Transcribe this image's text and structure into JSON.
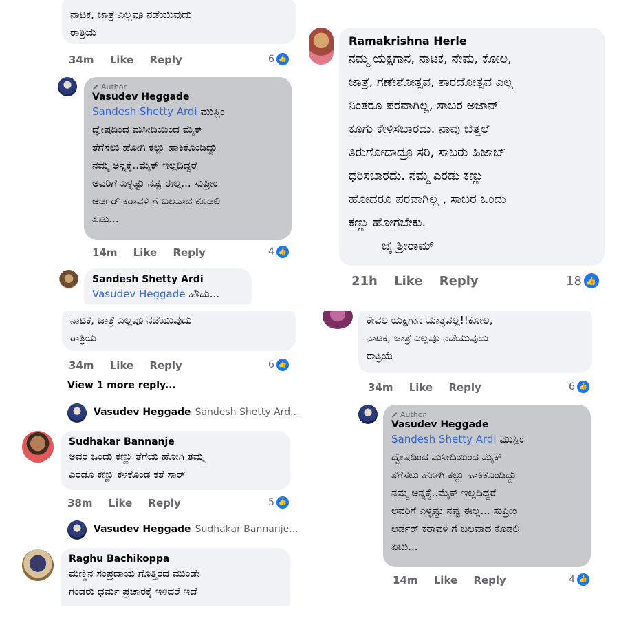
{
  "common": {
    "like": "Like",
    "reply": "Reply"
  },
  "tl": {
    "top_text": "ನಾಟಕ, ಜಾತ್ರೆ ಎಲ್ಲವೂ ನಡೆಯುವುದು",
    "top_text2": "ರಾತ್ರಿಯೆ",
    "top_time": "34m",
    "top_count": "6",
    "author_label": "Author",
    "reply_name": "Vasudev Heggade",
    "reply_mention": "Sandesh Shetty Ardi",
    "reply_line1": " ಮುಸ್ಲಿಂ",
    "reply_line2": "ದ್ವೇಷದಿಂದ ಮಸೀದಿಯಿಂದ ಮೈಕ್",
    "reply_line3": "ತೆಗೆಸಲು ಹೋಗಿ ಕಲ್ಲು ಹಾಕಿಕೊಂಡಿದ್ದು",
    "reply_line4": "ನಮ್ಮ ಅನ್ನಕ್ಕೆ..ಮೈಕ್ ಇಲ್ಲದಿದ್ದರೆ",
    "reply_line5": "ಅವರಿಗೆ ಎಳ್ಳಷ್ಟು ನಷ್ಟ ಈಲ್ಲ... ಸುಪ್ರೀಂ",
    "reply_line6": "ಆರ್ಡರ್ ಕರಾವಳಿ ಗೆ  ಬಲವಾದ ಕೊಡಲಿ",
    "reply_line7": "ಏಟು...",
    "reply_time": "14m",
    "reply_count": "4",
    "s_name": "Sandesh Shetty Ardi",
    "s_mention": "Vasudev Heggade",
    "s_text": " ಹೌದು..."
  },
  "tr": {
    "name": "Ramakrishna Herle",
    "line1": "ನಮ್ಮ ಯಕ್ಷಗಾನ, ನಾಟಕ, ನೇಮ, ಕೋಲ,",
    "line2": "ಜಾತ್ರೆ, ಗಣೇಶೋತ್ಸವ, ಶಾರದೋತ್ಸವ ಎಲ್ಲ",
    "line3": "ನಿಂತರೂ ಪರವಾಗಿಲ್ಲ, ಸಾಬರ ಅಜಾನ್",
    "line4": "ಕೂಗು ಕೇಳಿಸಬಾರದು. ನಾವು ಬೆತ್ತಲೆ",
    "line5": "ತಿರುಗೋದಾದ್ರೂ ಸರಿ, ಸಾಬರು ಹಿಜಾಬ್",
    "line6": "ಧರಿಸಬಾರದು. ನಮ್ಮ ಎರಡು ಕಣ್ಣು",
    "line7": "ಹೋದರೂ ಪರವಾಗಿಲ್ಲ , ಸಾಬರ ಒಂದು",
    "line8": "ಕಣ್ಣು ಹೋಗಬೇಕು.",
    "line9": "ಜೈ ಶ್ರೀರಾಮ್",
    "time": "21h",
    "count": "18"
  },
  "bl": {
    "top_text": "ನಾಟಕ, ಜಾತ್ರೆ ಎಲ್ಲವೂ ನಡೆಯುವುದು",
    "top_text2": "ರಾತ್ರಿಯೆ",
    "top_time": "34m",
    "top_count": "6",
    "view_more": "View 1 more reply...",
    "vr1_name": "Vasudev Heggade",
    "vr1_text": "Sandesh Shetty Ard...",
    "sud_name": "Sudhakar Bannanje",
    "sud_line1": "ಅವರ ಒಂದು ಕಣ್ಣು ತೆಗೆಯ ಹೋಗಿ ತಮ್ಮ",
    "sud_line2": "ಎರಡೂ ಕಣ್ಣು ಕಳಕೊಂಡ ಕತೆ ಸಾರ್",
    "sud_time": "38m",
    "sud_count": "5",
    "vr2_name": "Vasudev Heggade",
    "vr2_text": "Sudhakar Bannanje...",
    "rag_name": "Raghu Bachikoppa",
    "rag_line1": "ಮಣ್ಣಿನ ಸಂಪ್ರದಾಯ ಗೊತ್ತಿರದ ಮುಂಡೇ",
    "rag_line2": "ಗಂಡರು ಧರ್ಮ ಪ್ರಚಾರಕ್ಕೆ ಇಳಿದರೆ ಇದೆ"
  },
  "br": {
    "line1": "ಕೇವಲ ಯಕ್ಷಗಾನ ಮಾತ್ರವಲ್ಲ!!ಕೋಲ,",
    "line2": "ನಾಟಕ, ಜಾತ್ರೆ ಎಲ್ಲವೂ ನಡೆಯುವುದು",
    "line3": "ರಾತ್ರಿಯೆ",
    "time": "34m",
    "count": "6",
    "author_label": "Author",
    "reply_name": "Vasudev Heggade",
    "reply_mention": "Sandesh Shetty Ardi",
    "reply_line1": " ಮುಸ್ಲಿಂ",
    "reply_line2": "ದ್ವೇಷದಿಂದ ಮಸೀದಿಯಿಂದ ಮೈಕ್",
    "reply_line3": "ತೆಗೆಸಲು ಹೋಗಿ ಕಲ್ಲು ಹಾಕಿಕೊಂಡಿದ್ದು",
    "reply_line4": "ನಮ್ಮ ಅನ್ನಕ್ಕೆ..ಮೈಕ್ ಇಲ್ಲದಿದ್ದರೆ",
    "reply_line5": "ಅವರಿಗೆ ಎಳ್ಳಷ್ಟು ನಷ್ಟ ಈಲ್ಲ... ಸುಪ್ರೀಂ",
    "reply_line6": "ಆರ್ಡರ್ ಕರಾವಳಿ ಗೆ  ಬಲವಾದ ಕೊಡಲಿ",
    "reply_line7": "ಏಟು...",
    "reply_time": "14m",
    "reply_count": "4"
  },
  "icons": {
    "like": "like-reaction-icon",
    "pencil": "pencil-icon"
  },
  "colors": {
    "link": "#3467d6",
    "bubble": "#f0f2f5",
    "author_bubble": "#c8c9cc",
    "like_blue": "#1877f2"
  }
}
